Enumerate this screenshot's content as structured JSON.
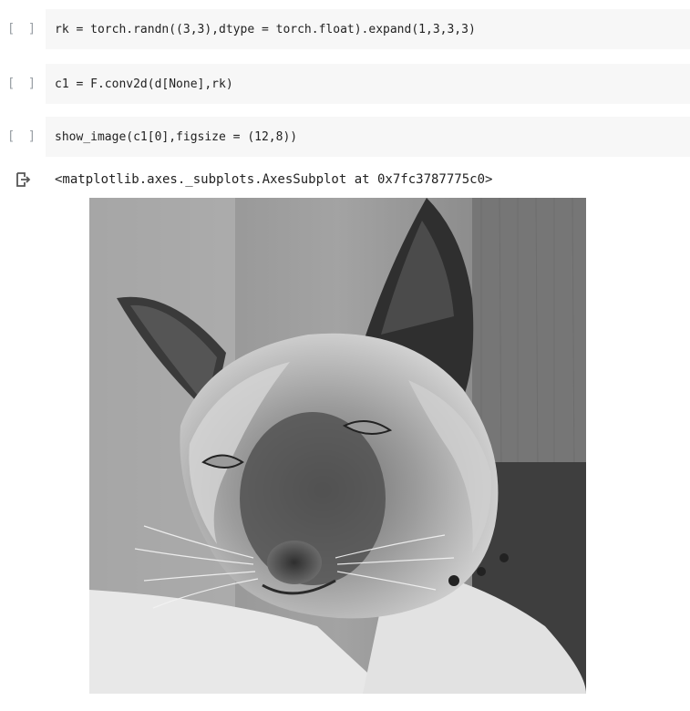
{
  "cells": [
    {
      "run_label": "[ ]",
      "code": "rk = torch.randn((3,3),dtype = torch.float).expand(1,3,3,3)"
    },
    {
      "run_label": "[ ]",
      "code": "c1 = F.conv2d(d[None],rk)"
    },
    {
      "run_label": "[ ]",
      "code": "show_image(c1[0],figsize = (12,8))"
    }
  ],
  "output": {
    "icon": "output-arrow-icon",
    "text": "<matplotlib.axes._subplots.AxesSubplot at 0x7fc3787775c0>"
  },
  "image": {
    "subject": "grayscale-cat-photo"
  },
  "colors": {
    "cell_background": "#f7f7f7",
    "run_bracket": "#9aa0a6",
    "text": "#222222"
  }
}
